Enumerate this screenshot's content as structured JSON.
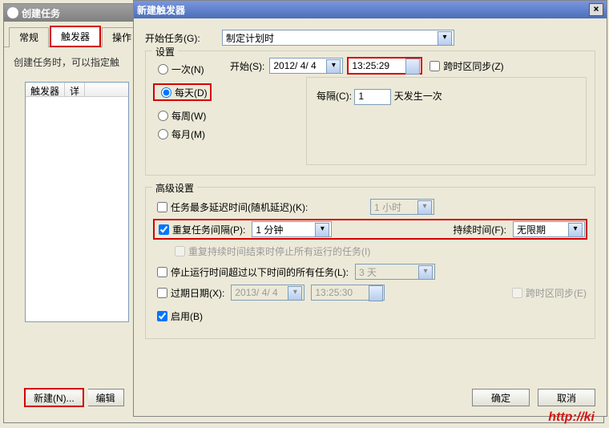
{
  "mainwin": {
    "title": "创建任务",
    "tabs": [
      "常规",
      "触发器",
      "操作"
    ],
    "activeTab": 1,
    "hint": "创建任务时，可以指定触",
    "list": {
      "col1": "触发器",
      "col2": "详"
    },
    "buttons": {
      "new": "新建(N)...",
      "edit": "编辑"
    }
  },
  "trig": {
    "title": "新建触发器",
    "startTask": {
      "label": "开始任务(G):",
      "value": "制定计划时"
    },
    "settings": {
      "legend": "设置",
      "radios": {
        "once": "一次(N)",
        "daily": "每天(D)",
        "weekly": "每周(W)",
        "monthly": "每月(M)"
      },
      "selected": "daily",
      "start": {
        "label": "开始(S):",
        "date": "2012/ 4/ 4",
        "time": "13:25:29"
      },
      "crossTZ": "跨时区同步(Z)",
      "recur": {
        "label": "每隔(C):",
        "value": "1",
        "suffix": "天发生一次"
      }
    },
    "adv": {
      "legend": "高级设置",
      "delay": {
        "label": "任务最多延迟时间(随机延迟)(K):",
        "value": "1 小时"
      },
      "repeat": {
        "label": "重复任务间隔(P):",
        "value": "1 分钟",
        "durLabel": "持续时间(F):",
        "durValue": "无限期"
      },
      "stopAtEnd": "重复持续时间结束时停止所有运行的任务(I)",
      "stopAfter": {
        "label": "停止运行时间超过以下时间的所有任务(L):",
        "value": "3 天"
      },
      "expire": {
        "label": "过期日期(X):",
        "date": "2013/ 4/ 4",
        "time": "13:25:30",
        "tz": "跨时区同步(E)"
      },
      "enabled": "启用(B)"
    },
    "buttons": {
      "ok": "确定",
      "cancel": "取消"
    }
  },
  "watermark": "http://ki"
}
